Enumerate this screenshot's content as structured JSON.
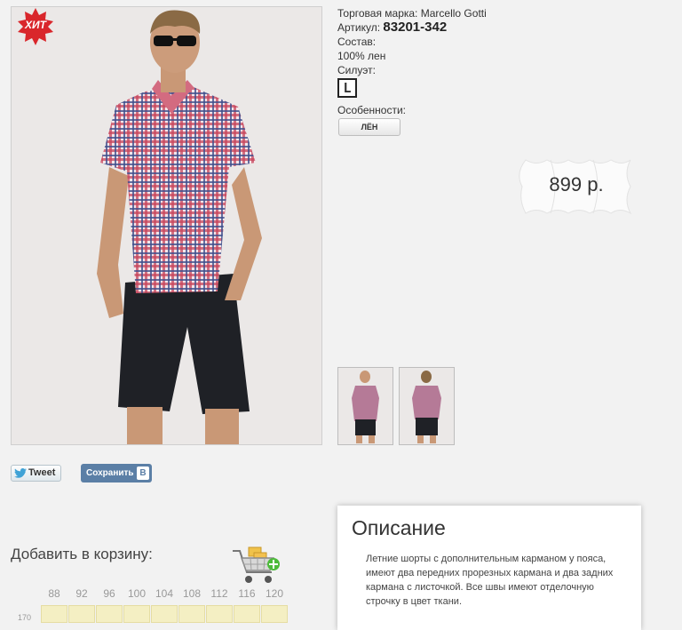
{
  "product": {
    "badge": "ХИТ",
    "brand_label": "Торговая марка:",
    "brand": "Marcello Gotti",
    "article_label": "Артикул:",
    "article": "83201-342",
    "composition_label": "Состав:",
    "composition": "100% лен",
    "silhouette_label": "Силуэт:",
    "silhouette": "L",
    "features_label": "Особенности:",
    "feature_tag": "ЛЁН",
    "price": "899 р."
  },
  "social": {
    "tweet": "Tweet",
    "vk_save": "Сохранить",
    "vk_letter": "В"
  },
  "cart": {
    "title": "Добавить в корзину:",
    "sizes": [
      "88",
      "92",
      "96",
      "100",
      "104",
      "108",
      "112",
      "116",
      "120"
    ],
    "row_label": "170"
  },
  "description": {
    "title": "Описание",
    "text": "Летние шорты с дополнительным карманом у пояса, имеют два передних прорезных кармана и два задних кармана с листочкой. Все швы имеют отделочную строчку в цвет ткани."
  },
  "colors": {
    "badge": "#d9262b",
    "accent_vk": "#5b7fa6",
    "size_cell": "#f4efc3"
  }
}
